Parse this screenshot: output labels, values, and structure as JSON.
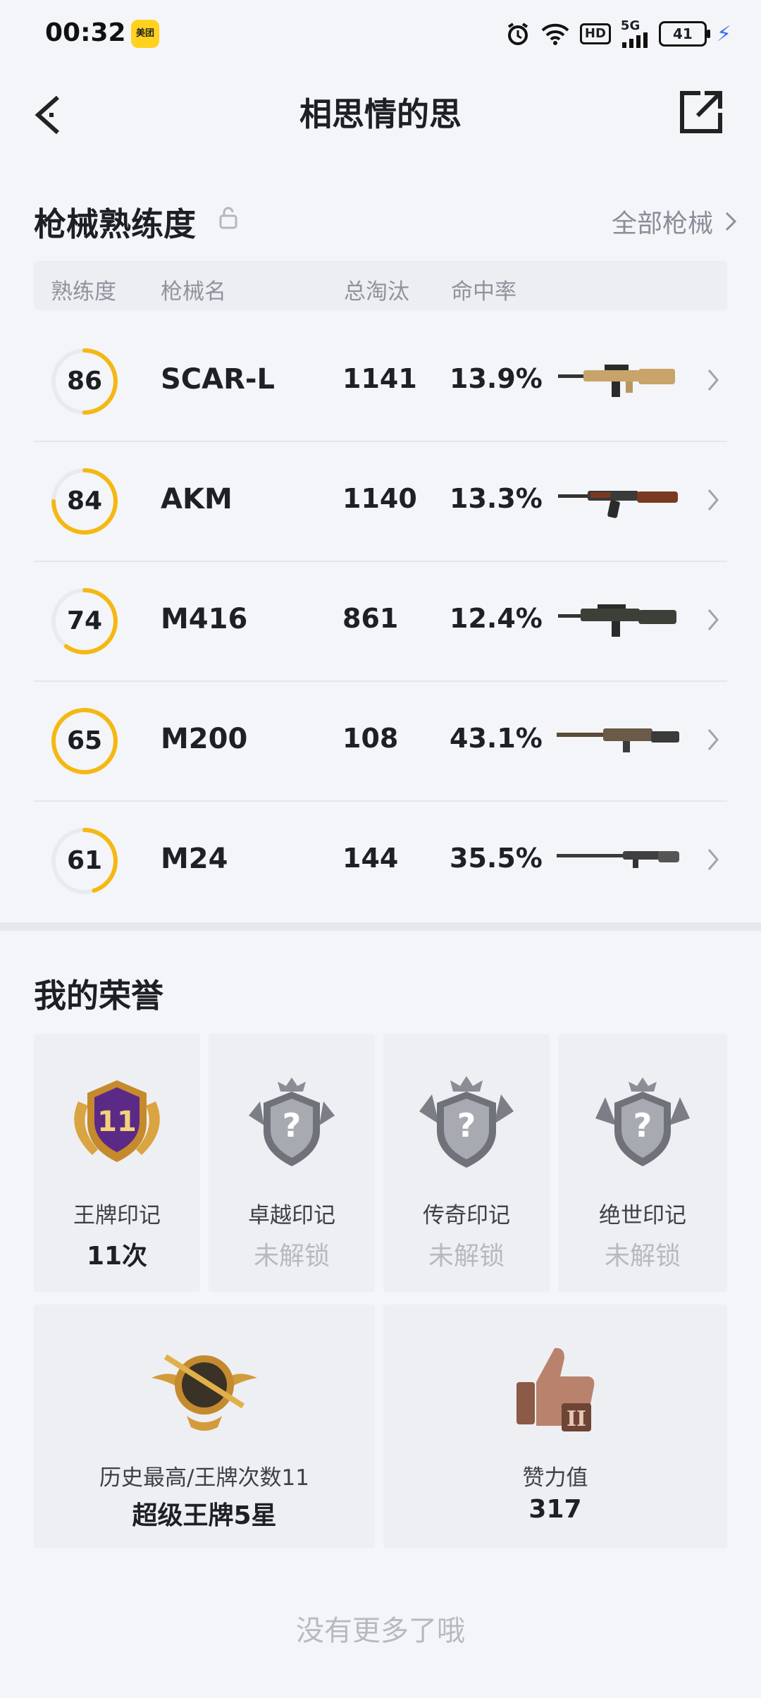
{
  "status_bar": {
    "time": "00:32",
    "app_badge": "美团",
    "hd": "HD",
    "signal": "5G",
    "battery": "41"
  },
  "header": {
    "title": "相思情的思"
  },
  "weapons": {
    "title": "枪械熟练度",
    "all_link": "全部枪械",
    "columns": {
      "proficiency": "熟练度",
      "name": "枪械名",
      "kills": "总淘汰",
      "hit_rate": "命中率"
    },
    "rows": [
      {
        "proficiency": "86",
        "name": "SCAR-L",
        "kills": "1141",
        "hit_rate": "13.9%",
        "progress": 0.5,
        "gun": "scar-l"
      },
      {
        "proficiency": "84",
        "name": "AKM",
        "kills": "1140",
        "hit_rate": "13.3%",
        "progress": 0.75,
        "gun": "akm"
      },
      {
        "proficiency": "74",
        "name": "M416",
        "kills": "861",
        "hit_rate": "12.4%",
        "progress": 0.6,
        "gun": "m416"
      },
      {
        "proficiency": "65",
        "name": "M200",
        "kills": "108",
        "hit_rate": "43.1%",
        "progress": 1.0,
        "gun": "m200"
      },
      {
        "proficiency": "61",
        "name": "M24",
        "kills": "144",
        "hit_rate": "35.5%",
        "progress": 0.45,
        "gun": "m24"
      }
    ]
  },
  "honors": {
    "title": "我的荣誉",
    "cards": [
      {
        "name": "王牌印记",
        "value": "11次",
        "badge_number": "11",
        "locked": false
      },
      {
        "name": "卓越印记",
        "value": "未解锁",
        "locked": true
      },
      {
        "name": "传奇印记",
        "value": "未解锁",
        "locked": true
      },
      {
        "name": "绝世印记",
        "value": "未解锁",
        "locked": true
      }
    ],
    "wide_cards": [
      {
        "name": "历史最高/王牌次数11",
        "value": "超级王牌5星"
      },
      {
        "name": "赞力值",
        "value": "317"
      }
    ]
  },
  "footer": {
    "text": "没有更多了哦"
  },
  "colors": {
    "accent": "#f5b812",
    "background": "#f4f5f8"
  }
}
